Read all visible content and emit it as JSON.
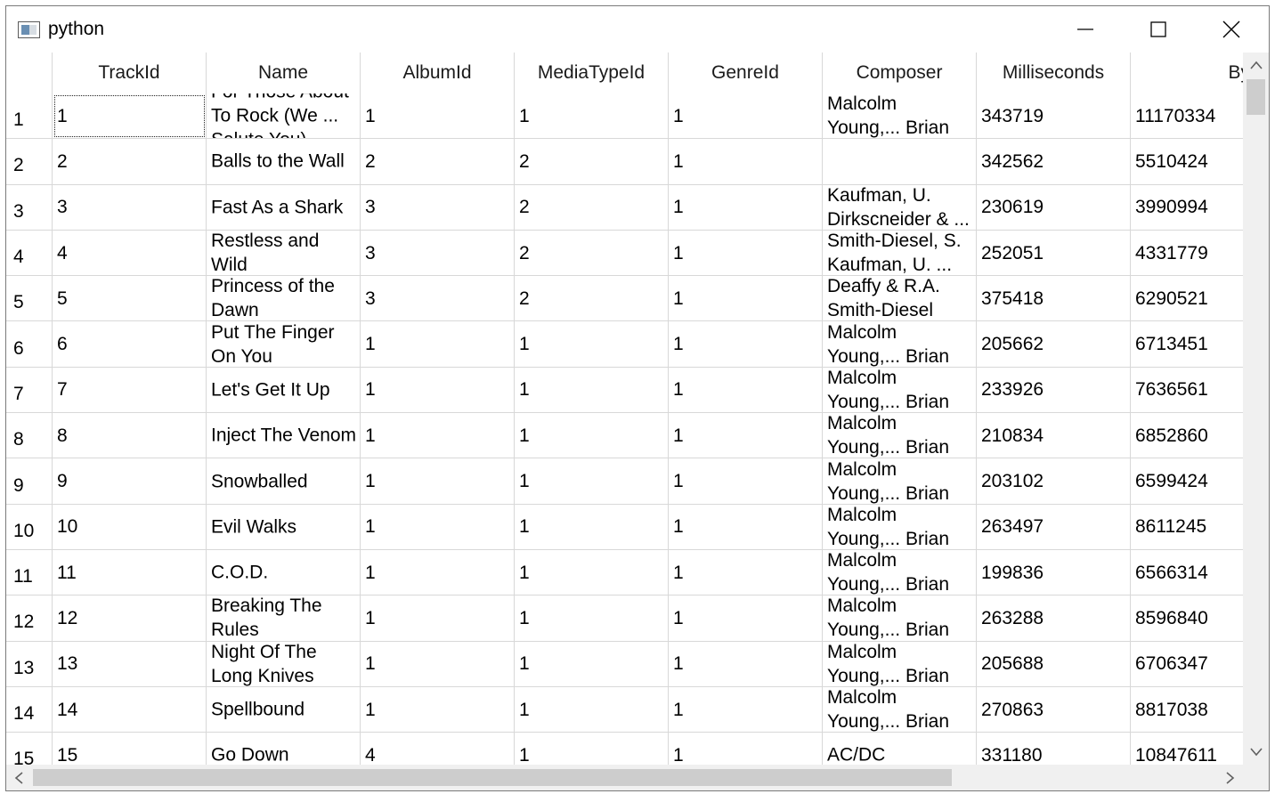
{
  "window": {
    "title": "python",
    "icon": "python-app-icon",
    "buttons": [
      "minimize-icon",
      "maximize-icon",
      "close-icon"
    ]
  },
  "table": {
    "columns": [
      "TrackId",
      "Name",
      "AlbumId",
      "MediaTypeId",
      "GenreId",
      "Composer",
      "Milliseconds",
      "Bytes"
    ],
    "rows": [
      {
        "header": "1",
        "cells": [
          "1",
          "For Those About To Rock (We ... Salute You)",
          "1",
          "1",
          "1",
          "Angus Young, Malcolm Young,... Brian Johnson",
          "343719",
          "11170334"
        ]
      },
      {
        "header": "2",
        "cells": [
          "2",
          "Balls to the Wall",
          "2",
          "2",
          "1",
          "",
          "342562",
          "5510424"
        ]
      },
      {
        "header": "3",
        "cells": [
          "3",
          "Fast As a Shark",
          "3",
          "2",
          "1",
          "Kaufman, U. Dirkscneider & ...",
          "230619",
          "3990994"
        ]
      },
      {
        "header": "4",
        "cells": [
          "4",
          "Restless and Wild",
          "3",
          "2",
          "1",
          "F. Baltes, R.A. Smith-Diesel, S. Kaufman, U. ... Dirkscneider &",
          "252051",
          "4331779"
        ]
      },
      {
        "header": "5",
        "cells": [
          "5",
          "Princess of the Dawn",
          "3",
          "2",
          "1",
          "Deaffy & R.A. Smith-Diesel",
          "375418",
          "6290521"
        ]
      },
      {
        "header": "6",
        "cells": [
          "6",
          "Put The Finger On You",
          "1",
          "1",
          "1",
          "Angus Young, Malcolm Young,... Brian Johnson",
          "205662",
          "6713451"
        ]
      },
      {
        "header": "7",
        "cells": [
          "7",
          "Let's Get It Up",
          "1",
          "1",
          "1",
          "Angus Young, Malcolm Young,... Brian Johnson",
          "233926",
          "7636561"
        ]
      },
      {
        "header": "8",
        "cells": [
          "8",
          "Inject The Venom",
          "1",
          "1",
          "1",
          "Angus Young, Malcolm Young,... Brian Johnson",
          "210834",
          "6852860"
        ]
      },
      {
        "header": "9",
        "cells": [
          "9",
          "Snowballed",
          "1",
          "1",
          "1",
          "Angus Young, Malcolm Young,... Brian Johnson",
          "203102",
          "6599424"
        ]
      },
      {
        "header": "10",
        "cells": [
          "10",
          "Evil Walks",
          "1",
          "1",
          "1",
          "Angus Young, Malcolm Young,... Brian Johnson",
          "263497",
          "8611245"
        ]
      },
      {
        "header": "11",
        "cells": [
          "11",
          "C.O.D.",
          "1",
          "1",
          "1",
          "Angus Young, Malcolm Young,... Brian Johnson",
          "199836",
          "6566314"
        ]
      },
      {
        "header": "12",
        "cells": [
          "12",
          "Breaking The Rules",
          "1",
          "1",
          "1",
          "Angus Young, Malcolm Young,... Brian Johnson",
          "263288",
          "8596840"
        ]
      },
      {
        "header": "13",
        "cells": [
          "13",
          "Night Of The Long Knives",
          "1",
          "1",
          "1",
          "Angus Young, Malcolm Young,... Brian Johnson",
          "205688",
          "6706347"
        ]
      },
      {
        "header": "14",
        "cells": [
          "14",
          "Spellbound",
          "1",
          "1",
          "1",
          "Angus Young, Malcolm Young,... Brian Johnson",
          "270863",
          "8817038"
        ]
      },
      {
        "header": "15",
        "cells": [
          "15",
          "Go Down",
          "4",
          "1",
          "1",
          "AC/DC",
          "331180",
          "10847611"
        ]
      }
    ]
  },
  "scrollbars": {
    "vertical": {
      "up": "chevron-up-icon",
      "down": "chevron-down-icon"
    },
    "horizontal": {
      "left": "chevron-left-icon",
      "right": "chevron-right-icon"
    }
  }
}
